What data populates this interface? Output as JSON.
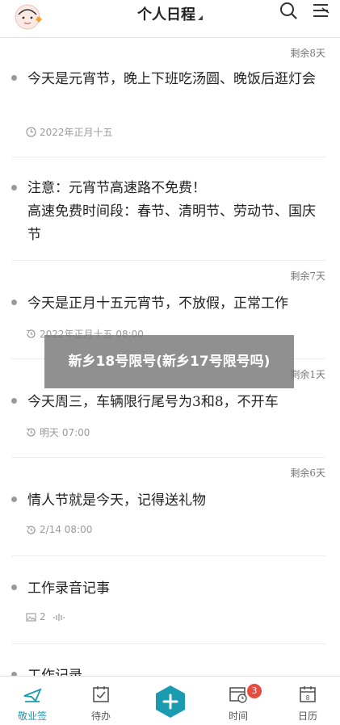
{
  "header": {
    "title": "个人日程"
  },
  "items": [
    {
      "remain": "剩余8天",
      "text": "今天是元宵节，晚上下班吃汤圆、晚饭后逛灯会",
      "meta": "2022年正月十五",
      "meta_icon": "clock-icon"
    },
    {
      "remain": "",
      "text": "注意：元宵节高速路不免费！\n高速免费时间段：春节、清明节、劳动节、国庆节",
      "meta": ""
    },
    {
      "remain": "剩余7天",
      "text": "今天是正月十五元宵节，不放假，正常工作",
      "meta": "2022年正月十五 08:00",
      "meta_icon": "repeat-clock-icon"
    },
    {
      "remain": "剩余1天",
      "text": "今天周三，车辆限行尾号为3和8，不开车",
      "meta": "明天 07:00",
      "meta_icon": "repeat-clock-icon"
    },
    {
      "remain": "剩余6天",
      "text": "情人节就是今天，记得送礼物",
      "meta": "2/14 08:00",
      "meta_icon": "repeat-clock-icon"
    },
    {
      "remain": "",
      "text": "工作录音记事",
      "meta": "2",
      "meta_icon": "image-icon"
    },
    {
      "remain": "",
      "text": "工作记录",
      "meta": ""
    }
  ],
  "overlay": {
    "text": "新乡18号限号(新乡17号限号吗)"
  },
  "tabbar": {
    "tabs": [
      {
        "label": "敬业签",
        "icon": "paper-plane-icon"
      },
      {
        "label": "待办",
        "icon": "check-calendar-icon"
      },
      {
        "label": "",
        "icon": "plus-icon"
      },
      {
        "label": "时间",
        "icon": "clock-calendar-icon",
        "badge": "3"
      },
      {
        "label": "日历",
        "icon": "calendar-icon"
      }
    ]
  },
  "colors": {
    "accent": "#1a9bb0",
    "badge": "#e84a3c"
  }
}
